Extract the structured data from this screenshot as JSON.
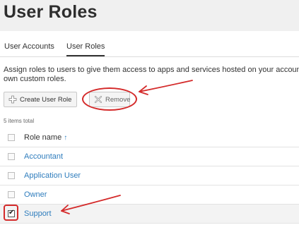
{
  "page": {
    "title": "User Roles"
  },
  "tabs": [
    {
      "label": "User Accounts",
      "active": false
    },
    {
      "label": "User Roles",
      "active": true
    }
  ],
  "intro": {
    "line1": "Assign roles to users to give them access to apps and services hosted on your account.",
    "line2": "own custom roles."
  },
  "toolbar": {
    "create_label": "Create User Role",
    "create_icon": "plus-icon",
    "remove_label": "Remove",
    "remove_icon": "remove-x-icon"
  },
  "list": {
    "count_text": "5 items total",
    "column_header": "Role name",
    "sort_icon": "sort-ascending-icon",
    "rows": [
      {
        "name": "Accountant",
        "checked": false
      },
      {
        "name": "Application User",
        "checked": false
      },
      {
        "name": "Owner",
        "checked": false
      },
      {
        "name": "Support",
        "checked": true
      }
    ]
  },
  "colors": {
    "accent": "#2f7dbd",
    "annotation": "#d42a2a"
  }
}
